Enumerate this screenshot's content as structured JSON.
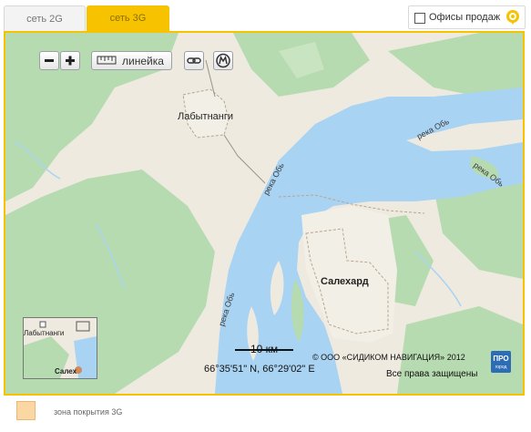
{
  "tabs": [
    {
      "label": "сеть 2G",
      "active": false
    },
    {
      "label": "сеть 3G",
      "active": true
    }
  ],
  "offices_toggle": {
    "label": "Офисы продаж",
    "checked": false
  },
  "toolbar": {
    "zoom_out_label": "−",
    "zoom_in_label": "+",
    "ruler_label": "линейка",
    "link_icon": "link-icon",
    "metro_icon": "metro-icon"
  },
  "map": {
    "places": [
      "Лабытнанги",
      "Салехард"
    ],
    "river_labels": [
      "река Обь",
      "река Обь",
      "река Обь",
      "река Обь"
    ],
    "scale_label": "10 км",
    "coordinates": "66°35'51\" N, 66°29'02\" E",
    "copyright": "© ООО «СИДИКОМ НАВИГАЦИЯ» 2012",
    "rights": "Все права защищены",
    "logo_text": [
      "ПРО",
      "город"
    ],
    "minimap": {
      "labels": [
        "Лабытнанги",
        "Салех"
      ]
    }
  },
  "legend": {
    "label": "зона покрытия 3G",
    "color": "#fbd7a3"
  },
  "colors": {
    "accent": "#f7c300",
    "water": "#a9d3f2",
    "forest": "#b7dbb0",
    "land": "#eeeae0"
  }
}
